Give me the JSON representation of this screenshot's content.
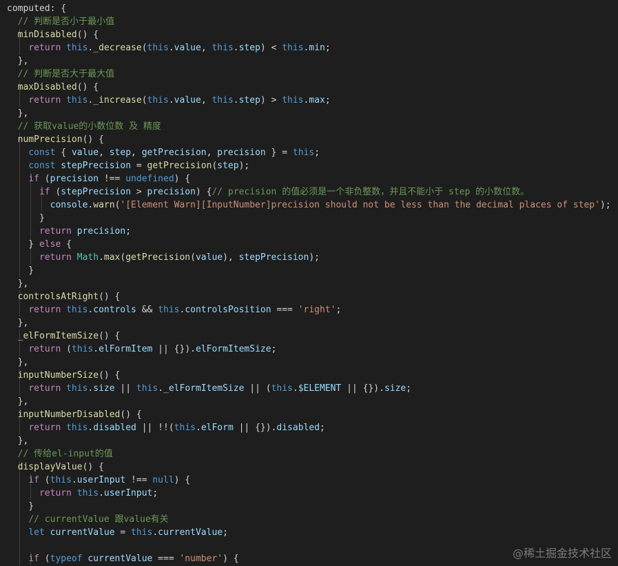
{
  "code": [
    [
      [
        "plain",
        "computed: {"
      ]
    ],
    [
      [
        "plain",
        "  "
      ],
      [
        "cmt",
        "// 判断是否小于最小值"
      ]
    ],
    [
      [
        "plain",
        "  "
      ],
      [
        "fn",
        "minDisabled"
      ],
      [
        "plain",
        "() {"
      ]
    ],
    [
      [
        "plain",
        "    "
      ],
      [
        "ctl",
        "return"
      ],
      [
        "plain",
        " "
      ],
      [
        "kw",
        "this"
      ],
      [
        "plain",
        "."
      ],
      [
        "fn",
        "_decrease"
      ],
      [
        "plain",
        "("
      ],
      [
        "kw",
        "this"
      ],
      [
        "plain",
        "."
      ],
      [
        "var",
        "value"
      ],
      [
        "plain",
        ", "
      ],
      [
        "kw",
        "this"
      ],
      [
        "plain",
        "."
      ],
      [
        "var",
        "step"
      ],
      [
        "plain",
        ") < "
      ],
      [
        "kw",
        "this"
      ],
      [
        "plain",
        "."
      ],
      [
        "var",
        "min"
      ],
      [
        "plain",
        ";"
      ]
    ],
    [
      [
        "plain",
        "  },"
      ]
    ],
    [
      [
        "plain",
        "  "
      ],
      [
        "cmt",
        "// 判断是否大于最大值"
      ]
    ],
    [
      [
        "plain",
        "  "
      ],
      [
        "fn",
        "maxDisabled"
      ],
      [
        "plain",
        "() {"
      ]
    ],
    [
      [
        "plain",
        "    "
      ],
      [
        "ctl",
        "return"
      ],
      [
        "plain",
        " "
      ],
      [
        "kw",
        "this"
      ],
      [
        "plain",
        "."
      ],
      [
        "fn",
        "_increase"
      ],
      [
        "plain",
        "("
      ],
      [
        "kw",
        "this"
      ],
      [
        "plain",
        "."
      ],
      [
        "var",
        "value"
      ],
      [
        "plain",
        ", "
      ],
      [
        "kw",
        "this"
      ],
      [
        "plain",
        "."
      ],
      [
        "var",
        "step"
      ],
      [
        "plain",
        ") > "
      ],
      [
        "kw",
        "this"
      ],
      [
        "plain",
        "."
      ],
      [
        "var",
        "max"
      ],
      [
        "plain",
        ";"
      ]
    ],
    [
      [
        "plain",
        "  },"
      ]
    ],
    [
      [
        "plain",
        "  "
      ],
      [
        "cmt",
        "// 获取value的小数位数 及 精度"
      ]
    ],
    [
      [
        "plain",
        "  "
      ],
      [
        "fn",
        "numPrecision"
      ],
      [
        "plain",
        "() {"
      ]
    ],
    [
      [
        "plain",
        "    "
      ],
      [
        "kw",
        "const"
      ],
      [
        "plain",
        " { "
      ],
      [
        "var",
        "value"
      ],
      [
        "plain",
        ", "
      ],
      [
        "var",
        "step"
      ],
      [
        "plain",
        ", "
      ],
      [
        "var",
        "getPrecision"
      ],
      [
        "plain",
        ", "
      ],
      [
        "var",
        "precision"
      ],
      [
        "plain",
        " } = "
      ],
      [
        "kw",
        "this"
      ],
      [
        "plain",
        ";"
      ]
    ],
    [
      [
        "plain",
        "    "
      ],
      [
        "kw",
        "const"
      ],
      [
        "plain",
        " "
      ],
      [
        "var",
        "stepPrecision"
      ],
      [
        "plain",
        " = "
      ],
      [
        "fn",
        "getPrecision"
      ],
      [
        "plain",
        "("
      ],
      [
        "var",
        "step"
      ],
      [
        "plain",
        ");"
      ]
    ],
    [
      [
        "plain",
        "    "
      ],
      [
        "ctl",
        "if"
      ],
      [
        "plain",
        " ("
      ],
      [
        "var",
        "precision"
      ],
      [
        "plain",
        " !== "
      ],
      [
        "kw",
        "undefined"
      ],
      [
        "plain",
        ") {"
      ]
    ],
    [
      [
        "plain",
        "      "
      ],
      [
        "ctl",
        "if"
      ],
      [
        "plain",
        " ("
      ],
      [
        "var",
        "stepPrecision"
      ],
      [
        "plain",
        " > "
      ],
      [
        "var",
        "precision"
      ],
      [
        "plain",
        ") {"
      ],
      [
        "cmt",
        "// precision 的值必须是一个非负整数，并且不能小于 step 的小数位数。"
      ]
    ],
    [
      [
        "plain",
        "        "
      ],
      [
        "var",
        "console"
      ],
      [
        "plain",
        "."
      ],
      [
        "fn",
        "warn"
      ],
      [
        "plain",
        "("
      ],
      [
        "str",
        "'[Element Warn][InputNumber]precision should not be less than the decimal places of step'"
      ],
      [
        "plain",
        ");"
      ]
    ],
    [
      [
        "plain",
        "      }"
      ]
    ],
    [
      [
        "plain",
        "      "
      ],
      [
        "ctl",
        "return"
      ],
      [
        "plain",
        " "
      ],
      [
        "var",
        "precision"
      ],
      [
        "plain",
        ";"
      ]
    ],
    [
      [
        "plain",
        "    } "
      ],
      [
        "ctl",
        "else"
      ],
      [
        "plain",
        " {"
      ]
    ],
    [
      [
        "plain",
        "      "
      ],
      [
        "ctl",
        "return"
      ],
      [
        "plain",
        " "
      ],
      [
        "type",
        "Math"
      ],
      [
        "plain",
        "."
      ],
      [
        "fn",
        "max"
      ],
      [
        "plain",
        "("
      ],
      [
        "fn",
        "getPrecision"
      ],
      [
        "plain",
        "("
      ],
      [
        "var",
        "value"
      ],
      [
        "plain",
        "), "
      ],
      [
        "var",
        "stepPrecision"
      ],
      [
        "plain",
        ");"
      ]
    ],
    [
      [
        "plain",
        "    }"
      ]
    ],
    [
      [
        "plain",
        "  },"
      ]
    ],
    [
      [
        "plain",
        "  "
      ],
      [
        "fn",
        "controlsAtRight"
      ],
      [
        "plain",
        "() {"
      ]
    ],
    [
      [
        "plain",
        "    "
      ],
      [
        "ctl",
        "return"
      ],
      [
        "plain",
        " "
      ],
      [
        "kw",
        "this"
      ],
      [
        "plain",
        "."
      ],
      [
        "var",
        "controls"
      ],
      [
        "plain",
        " && "
      ],
      [
        "kw",
        "this"
      ],
      [
        "plain",
        "."
      ],
      [
        "var",
        "controlsPosition"
      ],
      [
        "plain",
        " === "
      ],
      [
        "str",
        "'right'"
      ],
      [
        "plain",
        ";"
      ]
    ],
    [
      [
        "plain",
        "  },"
      ]
    ],
    [
      [
        "plain",
        "  "
      ],
      [
        "fn",
        "_elFormItemSize"
      ],
      [
        "plain",
        "() {"
      ]
    ],
    [
      [
        "plain",
        "    "
      ],
      [
        "ctl",
        "return"
      ],
      [
        "plain",
        " ("
      ],
      [
        "kw",
        "this"
      ],
      [
        "plain",
        "."
      ],
      [
        "var",
        "elFormItem"
      ],
      [
        "plain",
        " || {})."
      ],
      [
        "var",
        "elFormItemSize"
      ],
      [
        "plain",
        ";"
      ]
    ],
    [
      [
        "plain",
        "  },"
      ]
    ],
    [
      [
        "plain",
        "  "
      ],
      [
        "fn",
        "inputNumberSize"
      ],
      [
        "plain",
        "() {"
      ]
    ],
    [
      [
        "plain",
        "    "
      ],
      [
        "ctl",
        "return"
      ],
      [
        "plain",
        " "
      ],
      [
        "kw",
        "this"
      ],
      [
        "plain",
        "."
      ],
      [
        "var",
        "size"
      ],
      [
        "plain",
        " || "
      ],
      [
        "kw",
        "this"
      ],
      [
        "plain",
        "."
      ],
      [
        "var",
        "_elFormItemSize"
      ],
      [
        "plain",
        " || ("
      ],
      [
        "kw",
        "this"
      ],
      [
        "plain",
        "."
      ],
      [
        "var",
        "$ELEMENT"
      ],
      [
        "plain",
        " || {})."
      ],
      [
        "var",
        "size"
      ],
      [
        "plain",
        ";"
      ]
    ],
    [
      [
        "plain",
        "  },"
      ]
    ],
    [
      [
        "plain",
        "  "
      ],
      [
        "fn",
        "inputNumberDisabled"
      ],
      [
        "plain",
        "() {"
      ]
    ],
    [
      [
        "plain",
        "    "
      ],
      [
        "ctl",
        "return"
      ],
      [
        "plain",
        " "
      ],
      [
        "kw",
        "this"
      ],
      [
        "plain",
        "."
      ],
      [
        "var",
        "disabled"
      ],
      [
        "plain",
        " || !!("
      ],
      [
        "kw",
        "this"
      ],
      [
        "plain",
        "."
      ],
      [
        "var",
        "elForm"
      ],
      [
        "plain",
        " || {})."
      ],
      [
        "var",
        "disabled"
      ],
      [
        "plain",
        ";"
      ]
    ],
    [
      [
        "plain",
        "  },"
      ]
    ],
    [
      [
        "plain",
        "  "
      ],
      [
        "cmt",
        "// 传给el-input的值"
      ]
    ],
    [
      [
        "plain",
        "  "
      ],
      [
        "fn",
        "displayValue"
      ],
      [
        "plain",
        "() {"
      ]
    ],
    [
      [
        "plain",
        "    "
      ],
      [
        "ctl",
        "if"
      ],
      [
        "plain",
        " ("
      ],
      [
        "kw",
        "this"
      ],
      [
        "plain",
        "."
      ],
      [
        "var",
        "userInput"
      ],
      [
        "plain",
        " !== "
      ],
      [
        "kw",
        "null"
      ],
      [
        "plain",
        ") {"
      ]
    ],
    [
      [
        "plain",
        "      "
      ],
      [
        "ctl",
        "return"
      ],
      [
        "plain",
        " "
      ],
      [
        "kw",
        "this"
      ],
      [
        "plain",
        "."
      ],
      [
        "var",
        "userInput"
      ],
      [
        "plain",
        ";"
      ]
    ],
    [
      [
        "plain",
        "    }"
      ]
    ],
    [
      [
        "plain",
        "    "
      ],
      [
        "cmt",
        "// currentValue 跟value有关"
      ]
    ],
    [
      [
        "plain",
        "    "
      ],
      [
        "kw",
        "let"
      ],
      [
        "plain",
        " "
      ],
      [
        "var",
        "currentValue"
      ],
      [
        "plain",
        " = "
      ],
      [
        "kw",
        "this"
      ],
      [
        "plain",
        "."
      ],
      [
        "var",
        "currentValue"
      ],
      [
        "plain",
        ";"
      ]
    ],
    [
      [
        "plain",
        ""
      ]
    ],
    [
      [
        "plain",
        "    "
      ],
      [
        "ctl",
        "if"
      ],
      [
        "plain",
        " ("
      ],
      [
        "kw",
        "typeof"
      ],
      [
        "plain",
        " "
      ],
      [
        "var",
        "currentValue"
      ],
      [
        "plain",
        " === "
      ],
      [
        "str",
        "'number'"
      ],
      [
        "plain",
        ") {"
      ]
    ]
  ],
  "watermark": "@稀土掘金技术社区"
}
